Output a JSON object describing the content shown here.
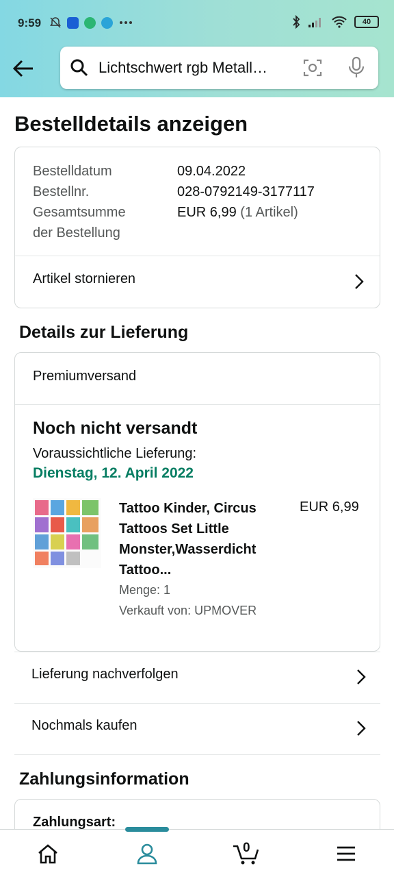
{
  "status_bar": {
    "time": "9:59",
    "battery": "40"
  },
  "search": {
    "query": "Lichtschwert rgb Metall…"
  },
  "page": {
    "title": "Bestelldetails anzeigen"
  },
  "order_summary": {
    "date_label": "Bestelldatum",
    "date_value": "09.04.2022",
    "number_label": "Bestellnr.",
    "number_value": "028-0792149-3177117",
    "total_label_line1": "Gesamtsumme",
    "total_label_line2": "der Bestellung",
    "total_value": "EUR 6,99",
    "total_count": "(1 Artikel)",
    "cancel_label": "Artikel stornieren"
  },
  "delivery": {
    "section_title": "Details zur Lieferung",
    "shipping_type": "Premiumversand",
    "status": "Noch nicht versandt",
    "eta_label": "Voraussichtliche Lieferung:",
    "eta_date": "Dienstag, 12. April 2022",
    "product": {
      "title": "Tattoo Kinder, Circus Tattoos Set Little Monster,Wasserdicht Tattoo...",
      "price": "EUR 6,99",
      "quantity": "Menge: 1",
      "seller": "Verkauft von: UPMOVER"
    },
    "track_label": "Lieferung nachverfolgen",
    "buy_again_label": "Nochmals kaufen"
  },
  "payment": {
    "section_title": "Zahlungsinformation",
    "method_label": "Zahlungsart:"
  },
  "bottom_nav": {
    "cart_count": "0"
  },
  "colors": {
    "accent_green": "#067d62",
    "nav_accent": "#2a8c9c",
    "header_gradient_start": "#84d8e3",
    "header_gradient_end": "#a6e4cf"
  }
}
